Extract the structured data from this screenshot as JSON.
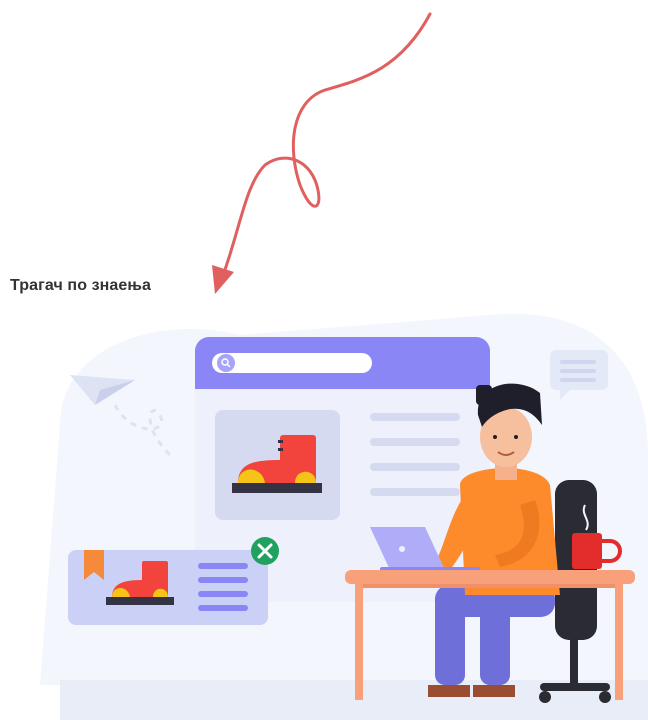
{
  "header": {
    "title": "Трагач по знаења"
  },
  "illustration": {
    "description_icons": [
      "search-icon",
      "paper-plane-icon",
      "chat-bubble-icon",
      "boot-icon",
      "bookmark-icon",
      "close-icon",
      "laptop-icon",
      "mug-icon"
    ],
    "colors": {
      "browser_header": "#8b86f6",
      "browser_body": "#eef1fb",
      "boot_red": "#f2433c",
      "boot_yellow": "#f6c416",
      "shirt_orange": "#fd8b2c",
      "pants_blue": "#6f6fd9",
      "desk": "#f8a07a",
      "close_green": "#20a160"
    }
  }
}
